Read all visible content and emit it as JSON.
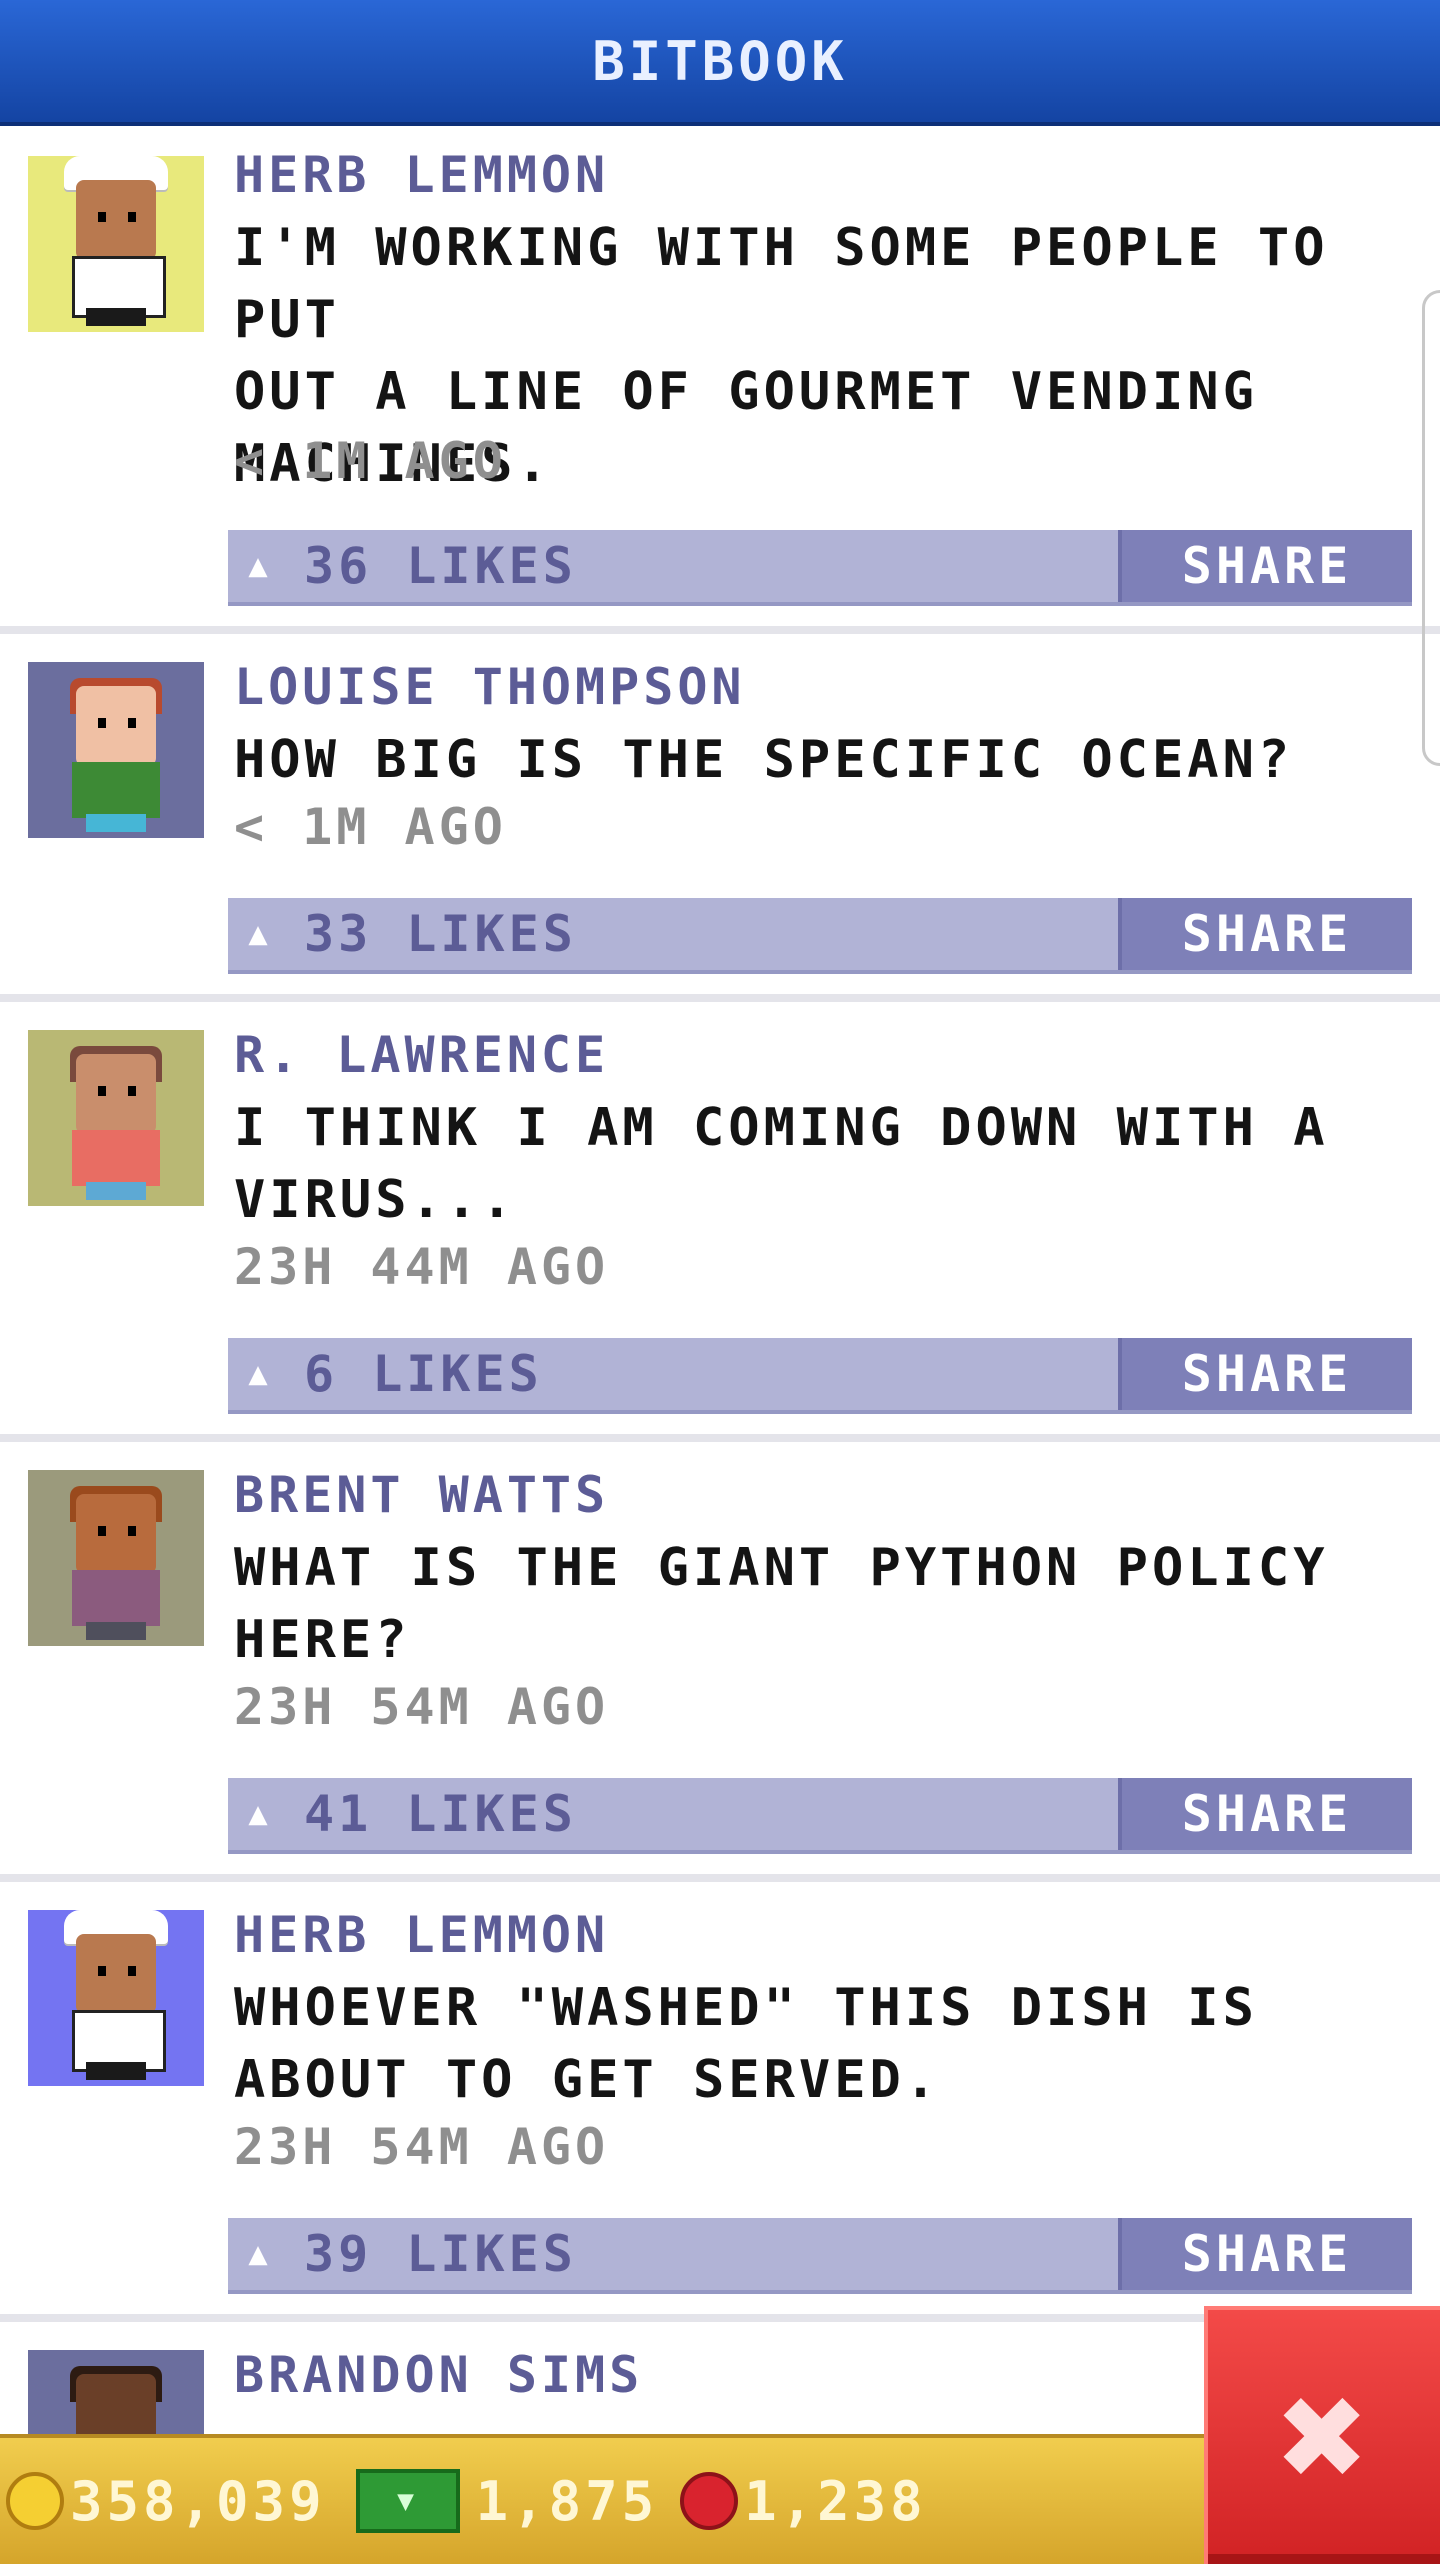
{
  "header": {
    "title": "BITBOOK"
  },
  "posts": [
    {
      "name": "HERB LEMMON",
      "text": "I'M WORKING WITH SOME PEOPLE TO PUT\nOUT A LINE OF GOURMET VENDING\nMACHINES.",
      "time": "< 1M AGO",
      "likes": "36 LIKES",
      "share": "SHARE"
    },
    {
      "name": "LOUISE THOMPSON",
      "text": "HOW BIG IS THE SPECIFIC OCEAN?",
      "time": "< 1M AGO",
      "likes": "33 LIKES",
      "share": "SHARE"
    },
    {
      "name": "R. LAWRENCE",
      "text": "I THINK I AM COMING DOWN WITH A\nVIRUS...",
      "time": "23H 44M AGO",
      "likes": "6 LIKES",
      "share": "SHARE"
    },
    {
      "name": "BRENT WATTS",
      "text": "WHAT IS THE GIANT PYTHON POLICY\nHERE?",
      "time": "23H 54M AGO",
      "likes": "41 LIKES",
      "share": "SHARE"
    },
    {
      "name": "HERB LEMMON",
      "text": "WHOEVER \"WASHED\" THIS DISH IS\nABOUT TO GET SERVED.",
      "time": "23H 54M AGO",
      "likes": "39 LIKES",
      "share": "SHARE"
    },
    {
      "name": "BRANDON SIMS"
    }
  ],
  "resources": {
    "coins": "358,039",
    "cash": "1,875",
    "bux": "1,238"
  },
  "icons": {
    "like": "thumbs-up-icon",
    "close": "close-icon",
    "coin": "coin-icon",
    "cash": "cash-icon",
    "bux": "bux-icon"
  },
  "colors": {
    "header": "#1f57c4",
    "name": "#5c5c96",
    "like_bar": "#b1b3d6",
    "share_button": "#7e80b8",
    "bottom_bar": "#e6b93a",
    "close_button": "#e33333"
  }
}
